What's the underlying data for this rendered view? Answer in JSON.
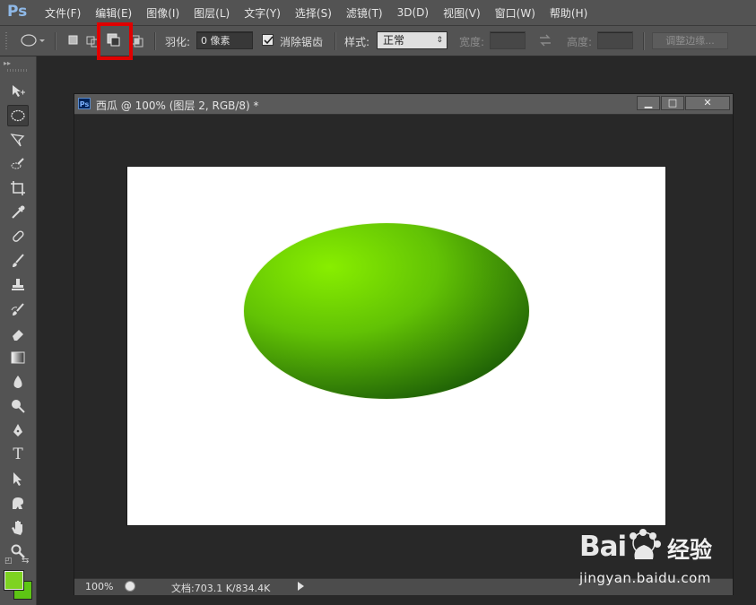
{
  "app": {
    "logo": "Ps"
  },
  "menu": [
    "文件(F)",
    "编辑(E)",
    "图像(I)",
    "图层(L)",
    "文字(Y)",
    "选择(S)",
    "滤镜(T)",
    "3D(D)",
    "视图(V)",
    "窗口(W)",
    "帮助(H)"
  ],
  "options": {
    "feather_label": "羽化:",
    "feather_value": "0 像素",
    "antialias_label": "消除锯齿",
    "antialias_checked": true,
    "style_label": "样式:",
    "style_value": "正常",
    "width_label": "宽度:",
    "height_label": "高度:",
    "refine_label": "调整边缘...",
    "active_selection_mode": "subtract-from-selection"
  },
  "tools": [
    "move-tool",
    "elliptical-marquee-tool",
    "lasso-tool",
    "quick-selection-tool",
    "crop-tool",
    "eyedropper-tool",
    "healing-brush-tool",
    "brush-tool",
    "clone-stamp-tool",
    "history-brush-tool",
    "eraser-tool",
    "gradient-tool",
    "blur-tool",
    "dodge-tool",
    "pen-tool",
    "type-tool",
    "path-selection-tool",
    "shape-tool",
    "hand-tool",
    "zoom-tool"
  ],
  "colors": {
    "foreground": "#7ed321",
    "background": "#5dc614",
    "ellipse_light": "#88ee00",
    "ellipse_dark": "#1b5c06"
  },
  "document": {
    "title": "西瓜 @ 100% (图层 2, RGB/8) *",
    "zoom": "100%",
    "doc_info": "文档:703.1 K/834.4K"
  },
  "watermark": {
    "brand": "Bai",
    "brand2": "经验",
    "url": "jingyan.baidu.com"
  }
}
